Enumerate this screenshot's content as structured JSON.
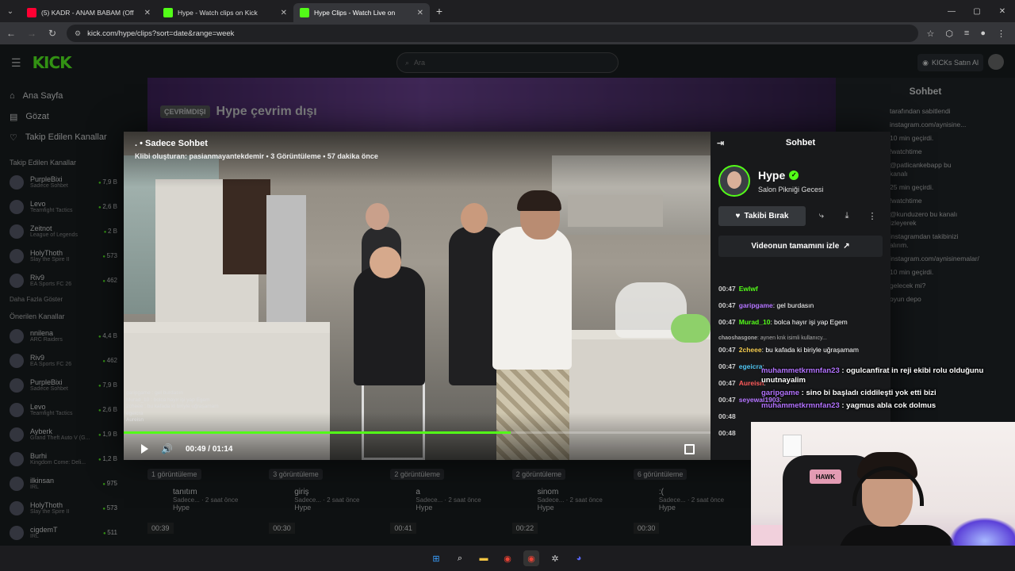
{
  "browser": {
    "tabs": [
      {
        "title": "(5) KADR - ANAM BABAM (Off",
        "fav": "#ff0033",
        "active": false
      },
      {
        "title": "Hype - Watch clips on Kick",
        "fav": "#53fc18",
        "active": false
      },
      {
        "title": "Hype Clips - Watch Live on",
        "fav": "#53fc18",
        "active": true
      }
    ],
    "url": "kick.com/hype/clips?sort=date&range=week"
  },
  "kick": {
    "logo": "KICK",
    "search_placeholder": "Ara",
    "kicks_button": "KICKs Satın Al",
    "nav": [
      "Ana Sayfa",
      "Gözat",
      "Takip Edilen Kanallar"
    ],
    "followed_heading": "Takip Edilen Kanallar",
    "followed": [
      {
        "name": "PurpleBixi",
        "game": "Sadece Sohbet",
        "viewers": "7,9 B"
      },
      {
        "name": "Levo",
        "game": "Teamfight Tactics",
        "viewers": "2,6 B"
      },
      {
        "name": "Zeitnot",
        "game": "League of Legends",
        "viewers": "2 B"
      },
      {
        "name": "HolyThoth",
        "game": "Slay the Spire II",
        "viewers": "573"
      },
      {
        "name": "Riv9",
        "game": "EA Sports FC 26",
        "viewers": "462"
      }
    ],
    "show_more": "Daha Fazla Göster",
    "recommended_heading": "Önerilen Kanallar",
    "recommended": [
      {
        "name": "nnilena",
        "game": "ARC Raiders",
        "viewers": "4,4 B"
      },
      {
        "name": "Riv9",
        "game": "EA Sports FC 26",
        "viewers": "462"
      },
      {
        "name": "PurpleBixi",
        "game": "Sadece Sohbet",
        "viewers": "7,9 B"
      },
      {
        "name": "Levo",
        "game": "Teamfight Tactics",
        "viewers": "2,6 B"
      },
      {
        "name": "Ayberk",
        "game": "Grand Theft Auto V (G...",
        "viewers": "1,9 B"
      },
      {
        "name": "Burhi",
        "game": "Kingdom Come: Deli...",
        "viewers": "1,2 B"
      },
      {
        "name": "ilkinsan",
        "game": "IRL",
        "viewers": "975"
      },
      {
        "name": "HolyThoth",
        "game": "Slay the Spire II",
        "viewers": "573"
      },
      {
        "name": "cigdemT",
        "game": "IRL",
        "viewers": "511"
      }
    ],
    "offline_badge": "ÇEVRİMDIŞI",
    "offline_title": "Hype çevrim dışı",
    "right_chat_title": "Sohbet",
    "right_chat_lines": [
      "tarafından sabitlendi",
      "instagram.com/aynisine...",
      "10 min geçirdi.",
      "!watchtime",
      "@patlicankebapp bu kanalı",
      "25 min geçirdi.",
      "!watchtime",
      "@kunduzero bu kanalı izleyerek",
      "instagramdan takibinizi alırım.",
      "instagram.com/aynisinemalar/",
      "10 min geçirdi.",
      "gelecek mi?",
      "oyun depo"
    ],
    "clips": [
      {
        "views": "1 görüntüleme",
        "title": "tanıtım",
        "sub": "Sadece... · 2 saat önce",
        "author": "Hype",
        "dur": "00:39"
      },
      {
        "views": "3 görüntüleme",
        "title": "giriş",
        "sub": "Sadece... · 2 saat önce",
        "author": "Hype",
        "dur": "00:30"
      },
      {
        "views": "2 görüntüleme",
        "title": "a",
        "sub": "Sadece... · 2 saat önce",
        "author": "Hype",
        "dur": "00:41"
      },
      {
        "views": "2 görüntüleme",
        "title": "sinom",
        "sub": "Sadece... · 2 saat önce",
        "author": "Hype",
        "dur": "00:22"
      },
      {
        "views": "6 görüntüleme",
        "title": ":(",
        "sub": "Sadece... · 2 saat önce",
        "author": "Hype",
        "dur": "00:30"
      }
    ]
  },
  "clip": {
    "title": ". • Sadece Sohbet",
    "meta": "Klibi oluşturan: pasianmayantekdemir • 3 Görüntüleme • 57 dakika önce",
    "time": "00:49 / 01:14",
    "progress": 0.66,
    "video_chat": [
      "garipgame : gel burdasın",
      "Murad_10 : bolca hayır işi yap Egem",
      "2cheee : bu kafada ki biriyle uğraşamam",
      "egeicra",
      "Aureisn"
    ]
  },
  "chat_panel": {
    "title": "Sohbet",
    "channel": "Hype",
    "category": "Salon Pikniği Gecesi",
    "unfollow": "Takibi Bırak",
    "watch_full": "Videonun tamamını izle",
    "messages": [
      {
        "ts": "00:47",
        "user": "Ewlwf",
        "color": "#53fc18",
        "text": ""
      },
      {
        "ts": "00:47",
        "user": "garipgame",
        "color": "#b373ff",
        "text": ": gel burdasın"
      },
      {
        "ts": "00:47",
        "user": "Murad_10",
        "color": "#53fc18",
        "text": ": bolca hayır işi yap Egem"
      },
      {
        "ts": "",
        "user": "chaoshasgone",
        "color": "#aaaaaa",
        "text": ": aynen knk isimli kullanıcy..."
      },
      {
        "ts": "00:47",
        "user": "2cheee",
        "color": "#f2c94c",
        "text": ": bu kafada ki biriyle uğraşamam"
      },
      {
        "ts": "00:47",
        "user": "egeicra",
        "color": "#4ec3f0",
        "text": ":"
      },
      {
        "ts": "00:47",
        "user": "Aureisn",
        "color": "#ff5a5a",
        "text": ":"
      },
      {
        "ts": "00:47",
        "user": "seyewal1903",
        "color": "#b373ff",
        "text": ":"
      },
      {
        "ts": "00:48",
        "user": "",
        "color": "#ffffff",
        "text": ""
      },
      {
        "ts": "00:48",
        "user": "",
        "color": "#ffffff",
        "text": ""
      }
    ]
  },
  "overlay_chat": [
    {
      "user": "muhammetkrmnfan23",
      "text": " : ogulcanfirat in reji ekibi rolu olduğunu unutnayalim"
    },
    {
      "user": "garipgame",
      "text": " : sino bi başladı ciddileşti yok etti bizi"
    },
    {
      "user": "muhammetkrmnfan23",
      "text": " : yagmus abla cok dolmus"
    }
  ],
  "webcam": {
    "chair_brand": "HAWK"
  },
  "colors": {
    "accent": "#53fc18",
    "bg": "#0b0e0f"
  }
}
